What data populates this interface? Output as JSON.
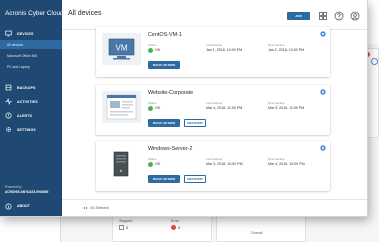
{
  "app": {
    "brand": "Acronis Cyber Cloud"
  },
  "sidebar": {
    "items": [
      {
        "label": "DEVICES",
        "icon": "monitor-icon"
      },
      {
        "label": "BACKUPS",
        "icon": "backup-icon"
      },
      {
        "label": "ACTIVITIES",
        "icon": "activities-icon"
      },
      {
        "label": "ALERTS",
        "icon": "alert-icon"
      },
      {
        "label": "SETTINGS",
        "icon": "gear-icon"
      }
    ],
    "subitems": [
      {
        "label": "All devices",
        "selected": true
      },
      {
        "label": "Microsoft Office 365",
        "selected": false
      },
      {
        "label": "PC and Laptop",
        "selected": false
      }
    ],
    "powered_by": "Powered by",
    "powered_brand": "ACRONIS ANYDATA ENGINE",
    "about": "ABOUT"
  },
  "header": {
    "title": "All devices",
    "add_label": "ADD",
    "icons": [
      "grid-icon",
      "help-icon",
      "user-icon"
    ]
  },
  "labels": {
    "status": "Status",
    "last_backup": "Last backup",
    "next_backup": "Next backup",
    "backup_now": "BACK UP NOW",
    "recover": "RECOVER"
  },
  "devices": [
    {
      "name": "CentOS-VM-1",
      "status": "OK",
      "last_backup": "Jan 1, 2018, 10:00 PM",
      "next_backup": "Jan 2, 2018, 10:00 PM",
      "thumb": "vm-icon"
    },
    {
      "name": "Website-Corporate",
      "status": "OK",
      "last_backup": "Mar 4, 2018, 11:00 PM",
      "next_backup": "Mar 5, 2018, 11:00 PM",
      "thumb": "website-icon"
    },
    {
      "name": "Windows-Server-2",
      "status": "OK",
      "last_backup": "Mar 3, 2018, 10:00 PM",
      "next_backup": "Mar 4, 2018, 10:00 PM",
      "thumb": "server-icon"
    }
  ],
  "footer": {
    "selected": "0/3 Selected"
  },
  "background": {
    "col1_label": "Stopped",
    "col1_value": "0",
    "col2_label": "Error",
    "col2_value": "0",
    "overall": "Overall"
  },
  "colors": {
    "sidebar": "#1f4872",
    "accent": "#2d6aa1",
    "ok": "#4caf50",
    "error": "#e74c3c"
  }
}
